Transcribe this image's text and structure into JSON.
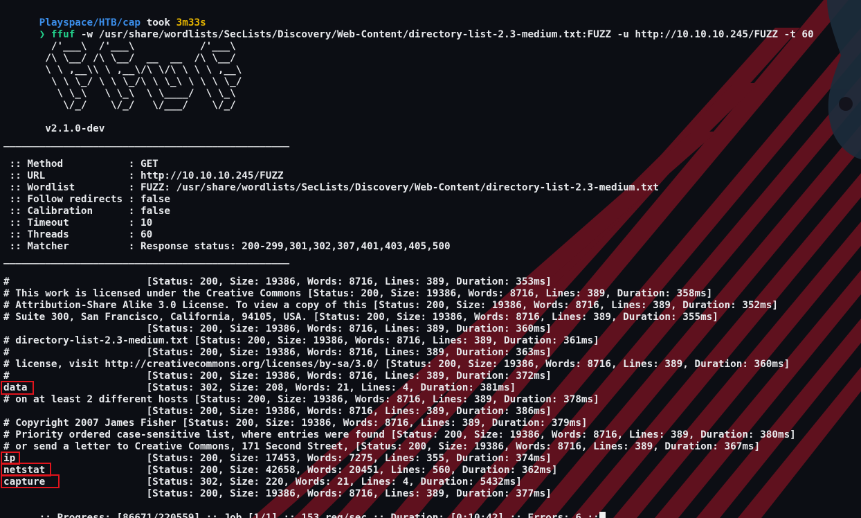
{
  "prompt": {
    "path": "Playspace/HTB/cap",
    "took_label": " took ",
    "duration": "3m33s",
    "arrow": "❯",
    "command_name": "ffuf",
    "command_args": " -w /usr/share/wordlists/SecLists/Discovery/Web-Content/directory-list-2.3-medium.txt:FUZZ -u http://10.10.10.245/FUZZ -t 60"
  },
  "banner": {
    "art": [
      "        /'___\\  /'___\\           /'___\\",
      "       /\\ \\__/ /\\ \\__/  __  __  /\\ \\__/",
      "       \\ \\ ,__\\\\ \\ ,__\\/\\ \\/\\ \\ \\ \\ ,__\\",
      "        \\ \\ \\_/ \\ \\ \\_/\\ \\ \\_\\ \\ \\ \\ \\_/",
      "         \\ \\_\\   \\ \\_\\  \\ \\____/  \\ \\_\\",
      "          \\/_/    \\/_/   \\/___/    \\/_/"
    ],
    "version": "       v2.1.0-dev",
    "separator": "________________________________________________"
  },
  "config": [
    " :: Method           : GET",
    " :: URL              : http://10.10.10.245/FUZZ",
    " :: Wordlist         : FUZZ: /usr/share/wordlists/SecLists/Discovery/Web-Content/directory-list-2.3-medium.txt",
    " :: Follow redirects : false",
    " :: Calibration      : false",
    " :: Timeout          : 10",
    " :: Threads          : 60",
    " :: Matcher          : Response status: 200-299,301,302,307,401,403,405,500"
  ],
  "results": [
    "#                       [Status: 200, Size: 19386, Words: 8716, Lines: 389, Duration: 353ms]",
    "# This work is licensed under the Creative Commons [Status: 200, Size: 19386, Words: 8716, Lines: 389, Duration: 358ms]",
    "# Attribution-Share Alike 3.0 License. To view a copy of this [Status: 200, Size: 19386, Words: 8716, Lines: 389, Duration: 352ms]",
    "# Suite 300, San Francisco, California, 94105, USA. [Status: 200, Size: 19386, Words: 8716, Lines: 389, Duration: 355ms]",
    "                        [Status: 200, Size: 19386, Words: 8716, Lines: 389, Duration: 360ms]",
    "# directory-list-2.3-medium.txt [Status: 200, Size: 19386, Words: 8716, Lines: 389, Duration: 361ms]",
    "#                       [Status: 200, Size: 19386, Words: 8716, Lines: 389, Duration: 363ms]",
    "# license, visit http://creativecommons.org/licenses/by-sa/3.0/ [Status: 200, Size: 19386, Words: 8716, Lines: 389, Duration: 360ms]",
    "#                       [Status: 200, Size: 19386, Words: 8716, Lines: 389, Duration: 372ms]",
    "data                    [Status: 302, Size: 208, Words: 21, Lines: 4, Duration: 381ms]",
    "# on at least 2 different hosts [Status: 200, Size: 19386, Words: 8716, Lines: 389, Duration: 378ms]",
    "                        [Status: 200, Size: 19386, Words: 8716, Lines: 389, Duration: 386ms]",
    "# Copyright 2007 James Fisher [Status: 200, Size: 19386, Words: 8716, Lines: 389, Duration: 379ms]",
    "# Priority ordered case-sensitive list, where entries were found [Status: 200, Size: 19386, Words: 8716, Lines: 389, Duration: 380ms]",
    "# or send a letter to Creative Commons, 171 Second Street, [Status: 200, Size: 19386, Words: 8716, Lines: 389, Duration: 367ms]",
    "ip                      [Status: 200, Size: 17453, Words: 7275, Lines: 355, Duration: 374ms]",
    "netstat                 [Status: 200, Size: 42658, Words: 20451, Lines: 560, Duration: 362ms]",
    "capture                 [Status: 302, Size: 220, Words: 21, Lines: 4, Duration: 5432ms]",
    "                        [Status: 200, Size: 19386, Words: 8716, Lines: 389, Duration: 377ms]"
  ],
  "progress": ":: Progress: [86671/220559] :: Job [1/1] :: 153 req/sec :: Duration: [0:10:42] :: Errors: 6 ::",
  "colors": {
    "path": "#3b8eea",
    "time": "#e5b400",
    "command": "#23d18b",
    "highlight": "#e0141c",
    "stripe": "#7a1420"
  }
}
